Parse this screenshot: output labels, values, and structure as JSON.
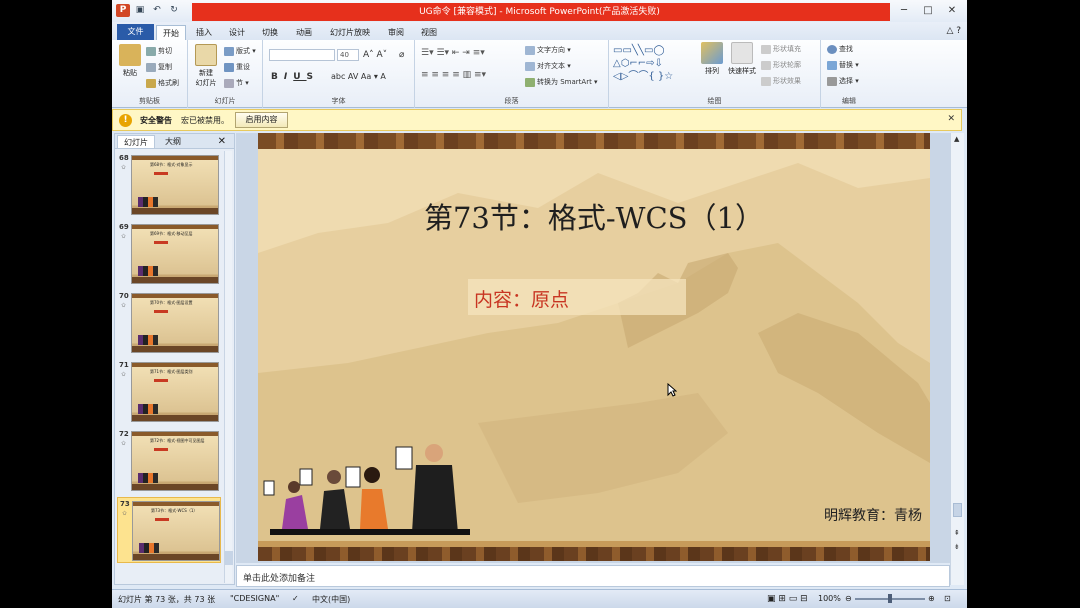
{
  "window": {
    "title": "UG命令 [兼容模式] - Microsoft PowerPoint(产品激活失败)",
    "controls": [
      "─",
      "□",
      "✕"
    ]
  },
  "tabs": [
    {
      "label": "文件"
    },
    {
      "label": "开始"
    },
    {
      "label": "插入"
    },
    {
      "label": "设计"
    },
    {
      "label": "切换"
    },
    {
      "label": "动画"
    },
    {
      "label": "幻灯片放映"
    },
    {
      "label": "审阅"
    },
    {
      "label": "视图"
    }
  ],
  "ribbon": {
    "clipboard": {
      "paste": "粘贴",
      "cut": "剪切",
      "copy": "复制",
      "format_painter": "格式刷",
      "label": "剪贴板"
    },
    "slides": {
      "new_slide": "新建\n幻灯片",
      "layout": "版式",
      "reset": "重设",
      "section": "节",
      "label": "幻灯片"
    },
    "font": {
      "font_size": "40",
      "label": "字体"
    },
    "paragraph": {
      "text_direction": "文字方向",
      "align_text": "对齐文本",
      "smartart": "转换为 SmartArt",
      "label": "段落"
    },
    "drawing": {
      "arrange": "排列",
      "quick_styles": "快速样式",
      "shape_fill": "形状填充",
      "shape_outline": "形状轮廓",
      "shape_effects": "形状效果",
      "label": "绘图"
    },
    "editing": {
      "find": "查找",
      "replace": "替换",
      "select": "选择",
      "label": "编辑"
    }
  },
  "security_bar": {
    "title": "安全警告",
    "message": "宏已被禁用。",
    "enable_button": "启用内容"
  },
  "slide_pane": {
    "tabs": [
      "幻灯片",
      "大纲"
    ],
    "thumbnails": [
      {
        "number": "68",
        "title": "第68节：格式-对象显示"
      },
      {
        "number": "69",
        "title": "第69节：格式-移动至层"
      },
      {
        "number": "70",
        "title": "第70节：格式-图层设置"
      },
      {
        "number": "71",
        "title": "第71节：格式-图层类别"
      },
      {
        "number": "72",
        "title": "第72节：格式-视图中可见图层"
      },
      {
        "number": "73",
        "title": "第73节：格式-WCS（1）"
      }
    ]
  },
  "slide": {
    "title": "第73节：格式-WCS（1）",
    "subtitle": "内容：原点",
    "credit": "明辉教育：青杨"
  },
  "notes_placeholder": "单击此处添加备注",
  "status": {
    "slide_info": "幻灯片 第 73 张，共 73 张",
    "theme": "\"CDESIGNA\"",
    "language": "中文(中国)",
    "zoom": "100%"
  },
  "colors": {
    "title_red": "#e6301c",
    "file_tab": "#2a5ba8",
    "subtitle_red": "#c83522",
    "slide_bg": "#efdbb0"
  }
}
